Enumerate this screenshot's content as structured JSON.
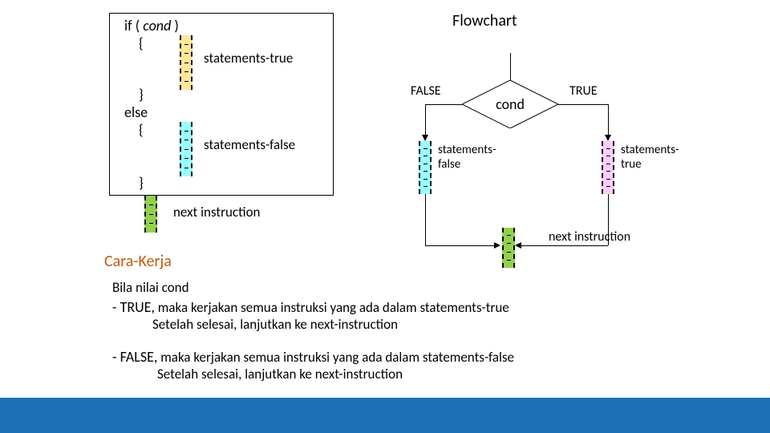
{
  "code": {
    "if": "if ( ",
    "cond": "cond",
    "if_close": " )",
    "brace_open": "{",
    "brace_close": "}",
    "else": "else",
    "label_true": "statements-true",
    "label_false": "statements-false",
    "label_next": "next instruction"
  },
  "flow": {
    "title": "Flowchart",
    "cond": "cond",
    "true": "TRUE",
    "false": "FALSE",
    "stmt_false_a": "statements-",
    "stmt_false_b": "false",
    "stmt_true_a": "statements-",
    "stmt_true_b": "true",
    "next": "next instruction"
  },
  "explain": {
    "title": "Cara-Kerja",
    "intro": "Bila nilai cond",
    "true_bullet": "- TRUE,",
    "true_line": " maka kerjakan semua instruksi yang ada dalam statements-true",
    "true_line2": "Setelah selesai, lanjutkan ke next-instruction",
    "false_bullet": "- FALSE,",
    "false_line": " maka kerjakan semua instruksi yang ada dalam statements-false",
    "false_line2": "Setelah selesai, lanjutkan ke next-instruction"
  }
}
